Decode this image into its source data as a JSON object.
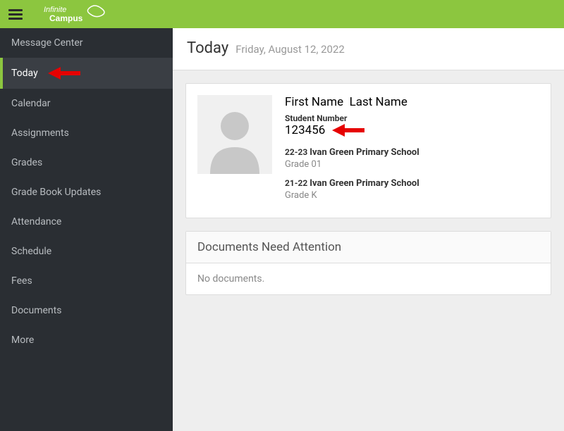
{
  "brand": "Infinite Campus",
  "sidebar": {
    "items": [
      {
        "label": "Message Center",
        "active": false,
        "name": "sidebar-item-message-center"
      },
      {
        "label": "Today",
        "active": true,
        "name": "sidebar-item-today"
      },
      {
        "label": "Calendar",
        "active": false,
        "name": "sidebar-item-calendar"
      },
      {
        "label": "Assignments",
        "active": false,
        "name": "sidebar-item-assignments"
      },
      {
        "label": "Grades",
        "active": false,
        "name": "sidebar-item-grades"
      },
      {
        "label": "Grade Book Updates",
        "active": false,
        "name": "sidebar-item-grade-book-updates"
      },
      {
        "label": "Attendance",
        "active": false,
        "name": "sidebar-item-attendance"
      },
      {
        "label": "Schedule",
        "active": false,
        "name": "sidebar-item-schedule"
      },
      {
        "label": "Fees",
        "active": false,
        "name": "sidebar-item-fees"
      },
      {
        "label": "Documents",
        "active": false,
        "name": "sidebar-item-documents"
      },
      {
        "label": "More",
        "active": false,
        "name": "sidebar-item-more"
      }
    ]
  },
  "page": {
    "title": "Today",
    "date": "Friday, August 12, 2022"
  },
  "student": {
    "first_name": "First Name",
    "last_name": "Last Name",
    "student_number_label": "Student Number",
    "student_number": "123456",
    "enrollments": [
      {
        "year": "22-23",
        "school": "Ivan Green Primary School",
        "grade": "Grade 01"
      },
      {
        "year": "21-22",
        "school": "Ivan Green Primary School",
        "grade": "Grade K"
      }
    ]
  },
  "documents": {
    "header": "Documents Need Attention",
    "empty_text": "No documents."
  },
  "annotations": {
    "arrow_color": "#e60000"
  }
}
